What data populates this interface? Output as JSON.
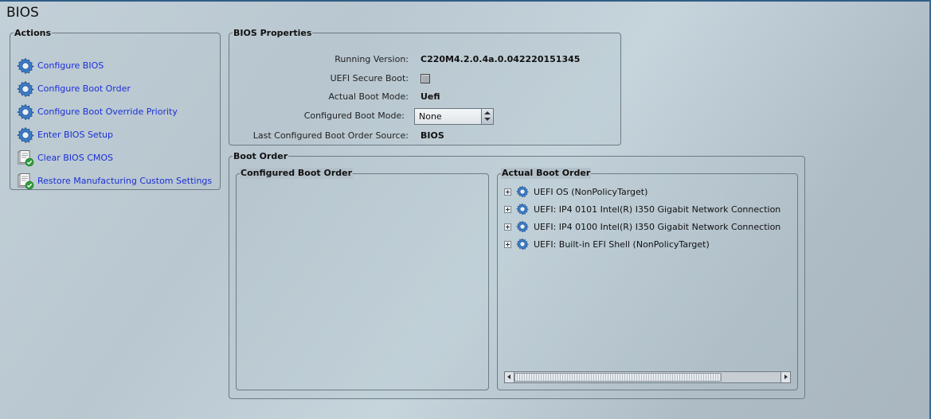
{
  "page": {
    "title": "BIOS"
  },
  "actions": {
    "legend": "Actions",
    "items": [
      {
        "label": "Configure BIOS",
        "icon": "gear-icon"
      },
      {
        "label": "Configure Boot Order",
        "icon": "gear-icon"
      },
      {
        "label": "Configure Boot Override Priority",
        "icon": "gear-icon"
      },
      {
        "label": "Enter BIOS Setup",
        "icon": "gear-icon"
      },
      {
        "label": "Clear BIOS CMOS",
        "icon": "clear-document-icon"
      },
      {
        "label": "Restore Manufacturing Custom Settings",
        "icon": "restore-document-icon"
      }
    ]
  },
  "bios_properties": {
    "legend": "BIOS Properties",
    "running_version_label": "Running Version:",
    "running_version_value": "C220M4.2.0.4a.0.042220151345",
    "uefi_secure_boot_label": "UEFI Secure Boot:",
    "uefi_secure_boot_checked": false,
    "actual_boot_mode_label": "Actual Boot Mode:",
    "actual_boot_mode_value": "Uefi",
    "configured_boot_mode_label": "Configured Boot Mode:",
    "configured_boot_mode_value": "None",
    "last_source_label": "Last Configured Boot Order Source:",
    "last_source_value": "BIOS"
  },
  "boot_order": {
    "legend": "Boot Order",
    "configured_legend": "Configured Boot Order",
    "configured_items": [],
    "actual_legend": "Actual Boot Order",
    "actual_items": [
      "UEFI OS (NonPolicyTarget)",
      "UEFI: IP4 0101 Intel(R) I350 Gigabit Network Connection",
      "UEFI: IP4 0100 Intel(R) I350 Gigabit Network Connection",
      "UEFI: Built-in EFI Shell  (NonPolicyTarget)"
    ]
  },
  "colors": {
    "link": "#1b2fd6",
    "frame_accent": "#2f5d86",
    "gear_icon": "#3d7cc9"
  }
}
